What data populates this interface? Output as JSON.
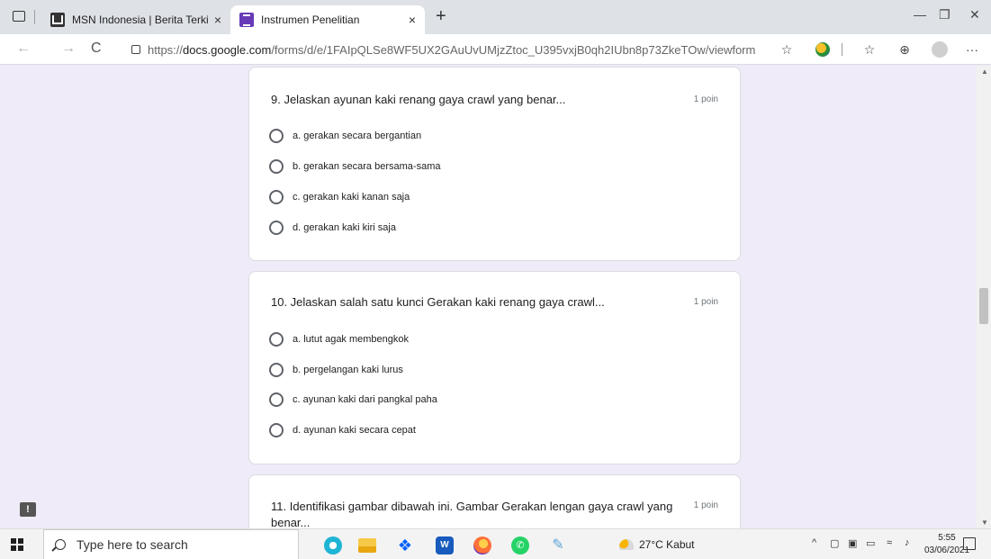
{
  "browser": {
    "tabs": [
      {
        "title": "MSN Indonesia | Berita Terkini H",
        "close": "×"
      },
      {
        "title": "Instrumen Penelitian",
        "close": "×"
      }
    ],
    "new_tab": "+",
    "window_controls": {
      "minimize": "—",
      "restore": "❐",
      "close": "✕"
    },
    "nav": {
      "back": "←",
      "forward": "→",
      "refresh": "C"
    },
    "url_prefix": "https://",
    "url_host": "docs.google.com",
    "url_path": "/forms/d/e/1FAIpQLSe8WF5UX2GAuUvUMjzZtoc_U395vxjB0qh2IUbn8p73ZkeTOw/viewform",
    "toolbar_icons": [
      "add-favorite-icon",
      "extension-icon",
      "favorites-icon",
      "collections-icon",
      "profile-icon",
      "more-icon"
    ],
    "more_label": "···"
  },
  "form": {
    "questions": [
      {
        "title": "9. Jelaskan ayunan kaki renang gaya crawl yang benar...",
        "points": "1 poin",
        "options": [
          "a. gerakan secara bergantian",
          "b. gerakan secara bersama-sama",
          "c. gerakan kaki kanan saja",
          "d. gerakan kaki kiri saja"
        ]
      },
      {
        "title": "10. Jelaskan salah satu kunci Gerakan kaki renang gaya crawl...",
        "points": "1 poin",
        "options": [
          "a. lutut agak membengkok",
          "b. pergelangan kaki lurus",
          "c. ayunan kaki dari pangkal paha",
          "d. ayunan kaki secara cepat"
        ]
      },
      {
        "title_line1": "11. Identifikasi gambar dibawah ini. Gambar Gerakan lengan gaya crawl yang",
        "title_line2": "benar...",
        "points": "1 poin"
      }
    ],
    "feedback_label": "!"
  },
  "taskbar": {
    "search_placeholder": "Type here to search",
    "apps": [
      "edge-icon",
      "file-explorer-icon",
      "dropbox-icon",
      "word-icon",
      "firefox-icon",
      "whatsapp-icon",
      "paint-icon"
    ],
    "weather": "27°C  Kabut",
    "time": "5:55",
    "date": "03/06/2021"
  },
  "colors": {
    "page_bg": "#f0ebf8",
    "forms_accent": "#673ab7"
  }
}
